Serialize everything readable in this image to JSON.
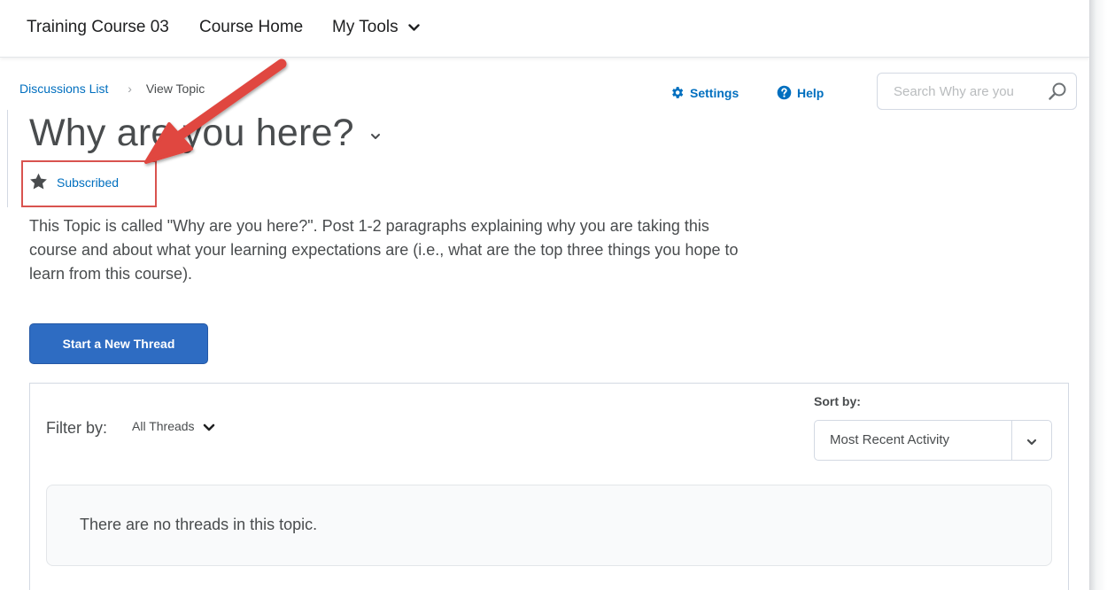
{
  "nav": {
    "course": "Training Course 03",
    "home": "Course Home",
    "tools": "My Tools"
  },
  "breadcrumb": {
    "parent": "Discussions List",
    "current": "View Topic"
  },
  "actions": {
    "settings": "Settings",
    "help": "Help"
  },
  "search": {
    "placeholder": "Search Why are you"
  },
  "topic": {
    "title": "Why are you here?",
    "subscribed": "Subscribed",
    "description": "This Topic is called \"Why are you here?\".  Post 1-2 paragraphs explaining why you are taking this course and about what your learning expectations are (i.e., what are the top three things you hope to learn from this course)."
  },
  "start_thread_button": "Start a New Thread",
  "threads": {
    "filter_label": "Filter by:",
    "filter_value": "All Threads",
    "sort_label": "Sort by:",
    "sort_value": "Most Recent Activity",
    "empty_message": "There are no threads in this topic."
  },
  "colors": {
    "link": "#006fbf",
    "primary_button": "#2e6cc2",
    "annotation": "#d9534f"
  },
  "icons": {
    "settings": "gear-icon",
    "help": "question-circle-icon",
    "search": "search-icon",
    "subscribed": "star-icon",
    "dropdown": "chevron-down-icon"
  }
}
